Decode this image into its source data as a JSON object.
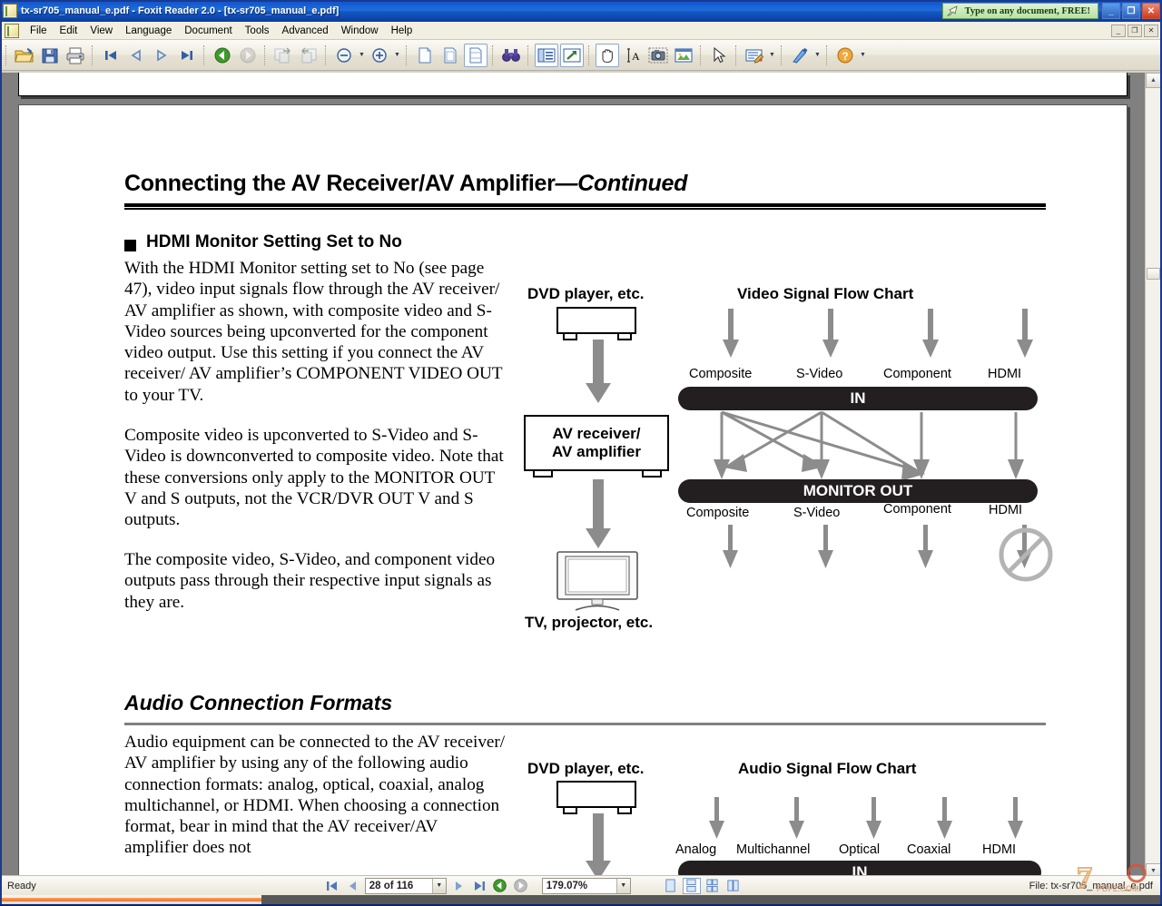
{
  "window": {
    "title": "tx-sr705_manual_e.pdf - Foxit Reader 2.0 - [tx-sr705_manual_e.pdf]",
    "promo_text": "Type on any document, FREE!",
    "minimize": "_",
    "maximize": "❐",
    "close": "✕",
    "inner_minimize": "_",
    "inner_restore": "❐",
    "inner_close": "✕"
  },
  "menu": {
    "items": [
      {
        "label": "File"
      },
      {
        "label": "Edit"
      },
      {
        "label": "View"
      },
      {
        "label": "Language"
      },
      {
        "label": "Document"
      },
      {
        "label": "Tools"
      },
      {
        "label": "Advanced"
      },
      {
        "label": "Window"
      },
      {
        "label": "Help"
      }
    ]
  },
  "toolbar": {
    "buttons": [
      {
        "name": "open-file",
        "icon": "folder-open-icon"
      },
      {
        "name": "save",
        "icon": "floppy-disk-icon"
      },
      {
        "name": "print",
        "icon": "printer-icon"
      },
      {
        "name": "first-page",
        "icon": "first-page-icon"
      },
      {
        "name": "previous-page",
        "icon": "previous-page-icon"
      },
      {
        "name": "next-page",
        "icon": "next-page-icon"
      },
      {
        "name": "last-page",
        "icon": "last-page-icon"
      },
      {
        "name": "previous-view",
        "icon": "back-green-icon"
      },
      {
        "name": "next-view",
        "icon": "forward-grey-icon"
      },
      {
        "name": "insert-pages",
        "icon": "pages-add-icon"
      },
      {
        "name": "delete-pages",
        "icon": "pages-remove-icon"
      },
      {
        "name": "zoom-out",
        "icon": "zoom-out-icon"
      },
      {
        "name": "zoom-in",
        "icon": "zoom-in-icon"
      },
      {
        "name": "actual-size",
        "icon": "page-actual-icon"
      },
      {
        "name": "fit-page",
        "icon": "page-fit-icon"
      },
      {
        "name": "fit-width",
        "icon": "page-width-icon"
      },
      {
        "name": "find",
        "icon": "binoculars-icon"
      },
      {
        "name": "show-bookmarks",
        "icon": "bookmarks-panel-icon"
      },
      {
        "name": "open-link",
        "icon": "external-link-icon"
      },
      {
        "name": "hand-tool",
        "icon": "hand-icon"
      },
      {
        "name": "select-text",
        "icon": "text-select-icon"
      },
      {
        "name": "snapshot",
        "icon": "camera-icon"
      },
      {
        "name": "image-tool",
        "icon": "image-icon"
      },
      {
        "name": "select-object",
        "icon": "cursor-arrow-icon"
      },
      {
        "name": "typewriter",
        "icon": "typewriter-icon"
      },
      {
        "name": "drawing-tools",
        "icon": "pen-tool-icon"
      },
      {
        "name": "help",
        "icon": "help-circle-icon"
      }
    ]
  },
  "status": {
    "ready": "Ready",
    "page_value": "28 of 116",
    "zoom_value": "179.07%",
    "file_label": "File: tx-sr705_manual_e.pdf",
    "first_page_icon": "first-page-icon",
    "prev_page_icon": "previous-page-icon",
    "next_page_icon": "next-page-icon",
    "last_page_icon": "last-page-icon",
    "prev_view_icon": "back-green-icon",
    "next_view_icon": "forward-grey-icon",
    "single_page_icon": "single-page-view-icon",
    "continuous_icon": "continuous-view-icon",
    "facing_icon": "facing-grid-view-icon",
    "continuous_facing_icon": "continuous-facing-view-icon"
  },
  "document": {
    "title_main": "Connecting the AV Receiver/AV Amplifier",
    "title_continued": "—Continued",
    "section_heading": "HDMI Monitor Setting Set to No",
    "paragraph_1": "With the HDMI Monitor setting set to No (see page 47), video input signals flow through the AV receiver/ AV amplifier as shown, with composite video and S-Video sources being upconverted for the component video output. Use this setting if you connect the AV receiver/ AV amplifier’s COMPONENT VIDEO OUT to your TV.",
    "paragraph_2": "Composite video is upconverted to S-Video and S-Video is downconverted to composite video. Note that these conversions only apply to the MONITOR OUT V and S outputs, not the VCR/DVR OUT V and S outputs.",
    "paragraph_3": "The composite video, S-Video, and component video outputs pass through their respective input signals as they are.",
    "audio_heading": "Audio Connection Formats",
    "paragraph_4": "Audio equipment can be connected to the AV receiver/ AV amplifier by using any of the following audio connection formats: analog, optical, coaxial, analog multichannel, or HDMI. When choosing a connection format, bear in mind that the AV receiver/AV amplifier does not"
  },
  "video_diagram": {
    "source_label": "DVD player, etc.",
    "device_label_line1": "AV receiver/",
    "device_label_line2": "AV amplifier",
    "sink_label": "TV, projector, etc.",
    "chart_title": "Video Signal Flow Chart",
    "in_bar_label": "IN",
    "out_bar_label": "MONITOR OUT",
    "in_ports": [
      "Composite",
      "S-Video",
      "Component",
      "HDMI"
    ],
    "out_ports": [
      "Composite",
      "S-Video",
      "Component",
      "HDMI"
    ],
    "hdmi_blocked": true
  },
  "audio_diagram": {
    "source_label": "DVD player, etc.",
    "chart_title": "Audio Signal Flow Chart",
    "in_bar_label": "IN",
    "in_ports": [
      "Analog",
      "Multichannel",
      "Optical",
      "Coaxial",
      "HDMI"
    ]
  },
  "colors": {
    "titlebar_blue": "#1f6ee0",
    "bar_black": "#231f20",
    "arrow_grey": "#898989",
    "page_grey_bg": "#808080",
    "promo_green": "#b9e3a4"
  }
}
